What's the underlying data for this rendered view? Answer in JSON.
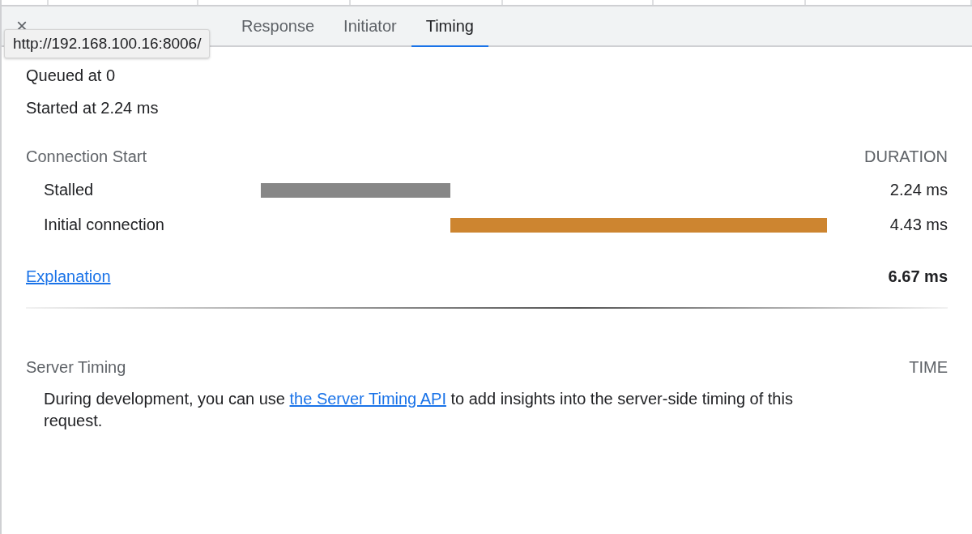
{
  "tabs": [
    {
      "label": "×",
      "kind": "close"
    },
    {
      "kind": "hidden"
    },
    {
      "kind": "hidden"
    },
    {
      "label": "Response",
      "kind": "tab",
      "selected": false
    },
    {
      "label": "Initiator",
      "kind": "tab",
      "selected": false
    },
    {
      "label": "Timing",
      "kind": "tab",
      "selected": true
    }
  ],
  "tooltip": "http://192.168.100.16:8006/",
  "summary": [
    "Queued at 0",
    "Started at 2.24 ms"
  ],
  "connection": {
    "heading": "Connection Start",
    "duration_heading": "DURATION",
    "phases": [
      {
        "name": "Stalled",
        "level": 0.335,
        "color": "#878787",
        "duration": "2.24 ms"
      },
      {
        "name": "Initial connection",
        "level": 0.665,
        "color": "#cd8530",
        "duration": "4.43 ms"
      }
    ],
    "link": "Explanation",
    "total": "6.67 ms"
  },
  "server_timing": {
    "heading": "Server Timing",
    "time_heading": "TIME",
    "text_before": "During development, you can use ",
    "link": "the Server Timing API",
    "text_after": " to add insights into the server-side timing of this request."
  }
}
